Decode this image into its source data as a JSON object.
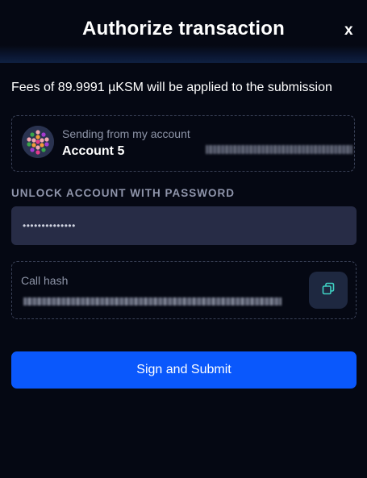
{
  "header": {
    "title": "Authorize transaction",
    "close_label": "x"
  },
  "fees": {
    "text": "Fees of 89.9991 µKSM will be applied to the submission"
  },
  "account": {
    "sending_label": "Sending from my account",
    "name": "Account 5",
    "avatar_icon": "identicon-avatar"
  },
  "password": {
    "section_label": "UNLOCK ACCOUNT WITH PASSWORD",
    "value": "••••••••••••••",
    "field_color": "#272c46"
  },
  "call_hash": {
    "label": "Call hash",
    "copy_icon": "copy-icon"
  },
  "submit": {
    "label": "Sign and Submit",
    "color": "#0a58fc"
  }
}
